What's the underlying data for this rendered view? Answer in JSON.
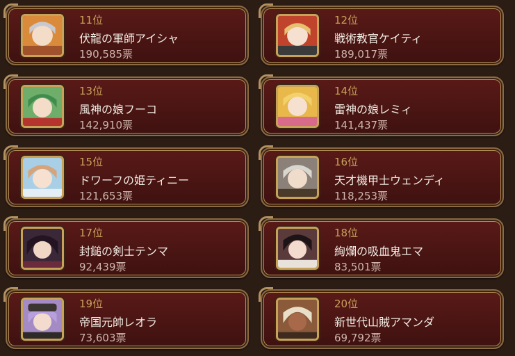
{
  "rankings": [
    {
      "rank": "11位",
      "name": "伏龍の軍師アイシャ",
      "votes": "190,585票",
      "avatar_icon": "character-portrait-icon"
    },
    {
      "rank": "12位",
      "name": "戦術教官ケイティ",
      "votes": "189,017票",
      "avatar_icon": "character-portrait-icon"
    },
    {
      "rank": "13位",
      "name": "風神の娘フーコ",
      "votes": "142,910票",
      "avatar_icon": "character-portrait-icon"
    },
    {
      "rank": "14位",
      "name": "雷神の娘レミィ",
      "votes": "141,437票",
      "avatar_icon": "character-portrait-icon"
    },
    {
      "rank": "15位",
      "name": "ドワーフの姫ティニー",
      "votes": "121,653票",
      "avatar_icon": "character-portrait-icon"
    },
    {
      "rank": "16位",
      "name": "天才機甲士ウェンディ",
      "votes": "118,253票",
      "avatar_icon": "character-portrait-icon"
    },
    {
      "rank": "17位",
      "name": "封鎚の剣士テンマ",
      "votes": "92,439票",
      "avatar_icon": "character-portrait-icon"
    },
    {
      "rank": "18位",
      "name": "絢爛の吸血鬼エマ",
      "votes": "83,501票",
      "avatar_icon": "character-portrait-icon"
    },
    {
      "rank": "19位",
      "name": "帝国元帥レオラ",
      "votes": "73,603票",
      "avatar_icon": "character-portrait-icon"
    },
    {
      "rank": "20位",
      "name": "新世代山賊アマンダ",
      "votes": "69,792票",
      "avatar_icon": "character-portrait-icon"
    }
  ],
  "colors": {
    "background": "#2b1c14",
    "card": "#4a1513",
    "gold_frame": "#c9a25a",
    "rank_text": "#c9a25a",
    "name_text": "#f2ece4",
    "votes_text": "#cfb6ab"
  }
}
